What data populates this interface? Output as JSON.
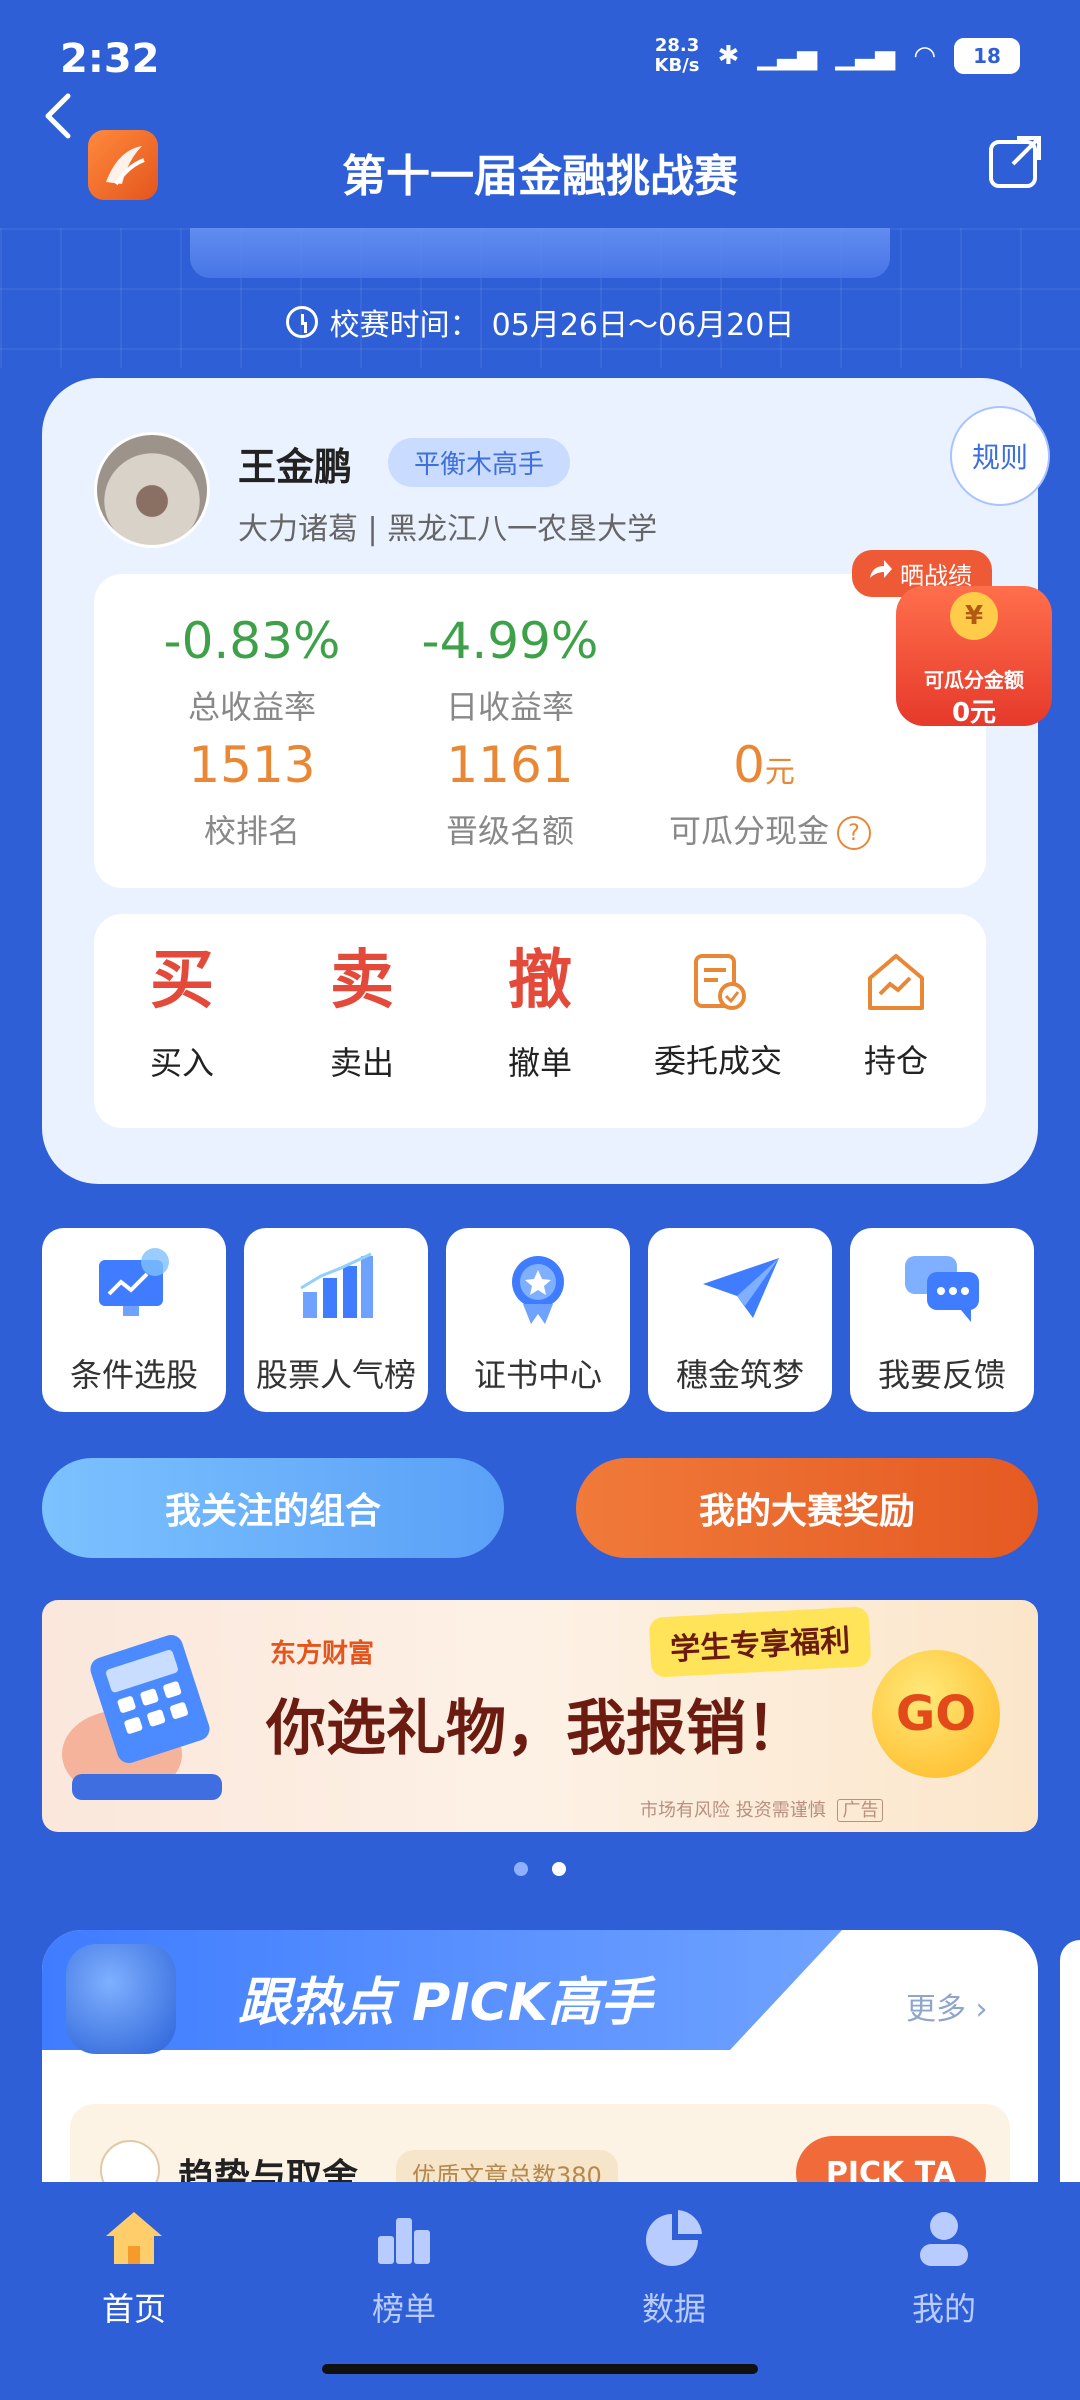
{
  "status_bar": {
    "time": "2:32",
    "net_speed": "28.3",
    "net_unit": "KB/s",
    "battery": "18"
  },
  "header": {
    "title": "第十一届金融挑战赛"
  },
  "contest": {
    "time_label": "校赛时间：",
    "time_range": "05月26日～06月20日"
  },
  "user": {
    "name": "王金鹏",
    "badge": "平衡木高手",
    "subtitle": "大力诸葛 | 黑龙江八一农垦大学",
    "rules_label": "规则"
  },
  "stats": {
    "total_return": {
      "value": "-0.83%",
      "label": "总收益率"
    },
    "daily_return": {
      "value": "-4.99%",
      "label": "日收益率"
    },
    "school_rank": {
      "value": "1513",
      "label": "校排名"
    },
    "promotion_quota": {
      "value": "1161",
      "label": "晋级名额"
    },
    "cash_share": {
      "value": "0",
      "unit": "元",
      "label": "可瓜分现金",
      "help": "?"
    }
  },
  "share_badge": {
    "tag": "晒战绩",
    "coin": "¥",
    "label": "可瓜分金额",
    "amount": "0元"
  },
  "trade": [
    {
      "char": "买",
      "label": "买入"
    },
    {
      "char": "卖",
      "label": "卖出"
    },
    {
      "char": "撤",
      "label": "撤单"
    },
    {
      "icon": "order-record-icon",
      "label": "委托成交"
    },
    {
      "icon": "holdings-house-icon",
      "label": "持仓"
    }
  ],
  "tools": [
    {
      "icon": "monitor-chart-icon",
      "label": "条件选股"
    },
    {
      "icon": "bar-rank-icon",
      "label": "股票人气榜"
    },
    {
      "icon": "certificate-medal-icon",
      "label": "证书中心"
    },
    {
      "icon": "paper-plane-icon",
      "label": "穗金筑梦"
    },
    {
      "icon": "feedback-chat-icon",
      "label": "我要反馈"
    }
  ],
  "actions": {
    "follow": "我关注的组合",
    "reward": "我的大赛奖励"
  },
  "promo": {
    "brand": "东方财富",
    "tag": "学生专享福利",
    "title": "你选礼物，我报销！",
    "go": "GO",
    "note": "市场有风险 投资需谨慎",
    "ad_mark": "广告"
  },
  "hot": {
    "title": "跟热点 PICK高手",
    "more": "更多",
    "item_name": "趋势与取舍",
    "item_tag": "优质文章总数380",
    "pick_button": "PICK TA"
  },
  "nav": [
    {
      "label": "首页",
      "icon": "home-icon",
      "active": true
    },
    {
      "label": "榜单",
      "icon": "ranking-icon",
      "active": false
    },
    {
      "label": "数据",
      "icon": "pie-chart-icon",
      "active": false
    },
    {
      "label": "我的",
      "icon": "profile-icon",
      "active": false
    }
  ],
  "colors": {
    "background": "#2f5fd6",
    "accent_orange": "#e55a22",
    "gain_green": "#3ea049",
    "sell_red": "#e34a3a"
  }
}
